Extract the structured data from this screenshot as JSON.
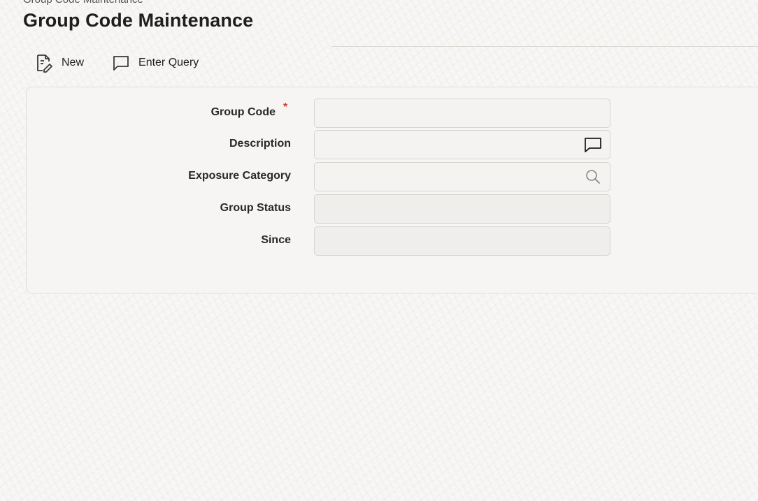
{
  "window": {
    "title_fragment": "Group Code Maintenance"
  },
  "page": {
    "title": "Group Code Maintenance"
  },
  "toolbar": {
    "new_label": "New",
    "enter_query_label": "Enter Query",
    "new_icon": "new-document-icon",
    "enter_query_icon": "comment-bubble-icon"
  },
  "form": {
    "fields": [
      {
        "label": "Group Code",
        "required": true,
        "value": ""
      },
      {
        "label": "Description",
        "required": false,
        "value": "",
        "icon": "comment-bubble-icon"
      },
      {
        "label": "Exposure Category",
        "required": false,
        "value": "",
        "icon": "search-icon"
      },
      {
        "label": "Group Status",
        "required": false,
        "value": ""
      },
      {
        "label": "Since",
        "required": false,
        "value": ""
      }
    ],
    "required_marker": "*"
  },
  "colors": {
    "required": "#c74634",
    "title": "#1f1e1c"
  }
}
